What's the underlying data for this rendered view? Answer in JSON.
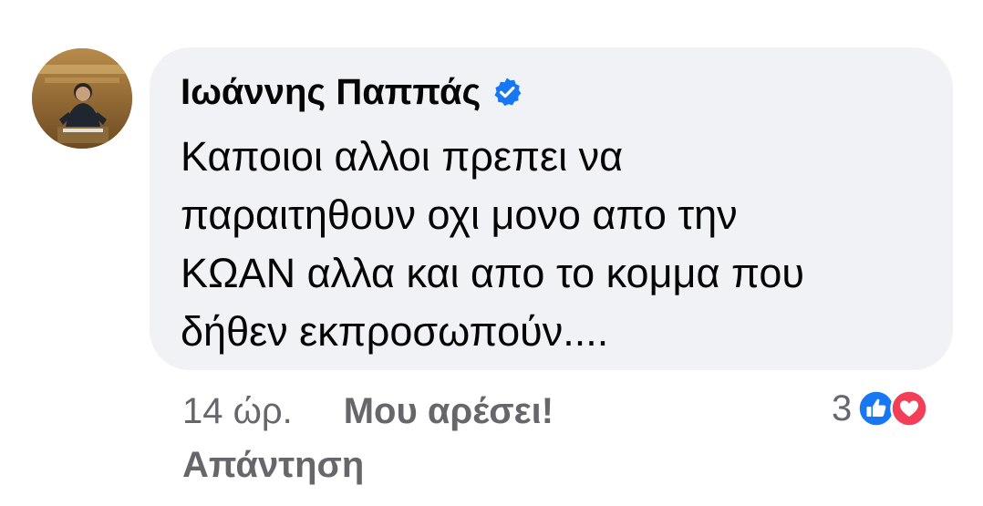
{
  "comment": {
    "author": {
      "name": "Ιωάννης Παππάς",
      "verified": true,
      "avatar_icon": "profile-photo-speaker-at-podium"
    },
    "text": "Καποιοι αλλοι πρεπει να\nπαραιτηθουν οχι μονο απο την\nΚΩΑΝ αλλα και απο το κομμα που\nδήθεν εκπροσωπούν....",
    "timestamp": "14 ώρ.",
    "actions": {
      "like_label": "Μου αρέσει!",
      "reply_label": "Απάντηση"
    },
    "reactions": {
      "count": "3",
      "types": [
        "like-icon",
        "love-icon"
      ]
    }
  },
  "colors": {
    "bubble_background": "#f0f2f5",
    "primary_text": "#050505",
    "secondary_text": "#65676b",
    "verified_blue": "#1877f2",
    "like_blue": "#1877f2",
    "love_red": "#f33e58"
  }
}
